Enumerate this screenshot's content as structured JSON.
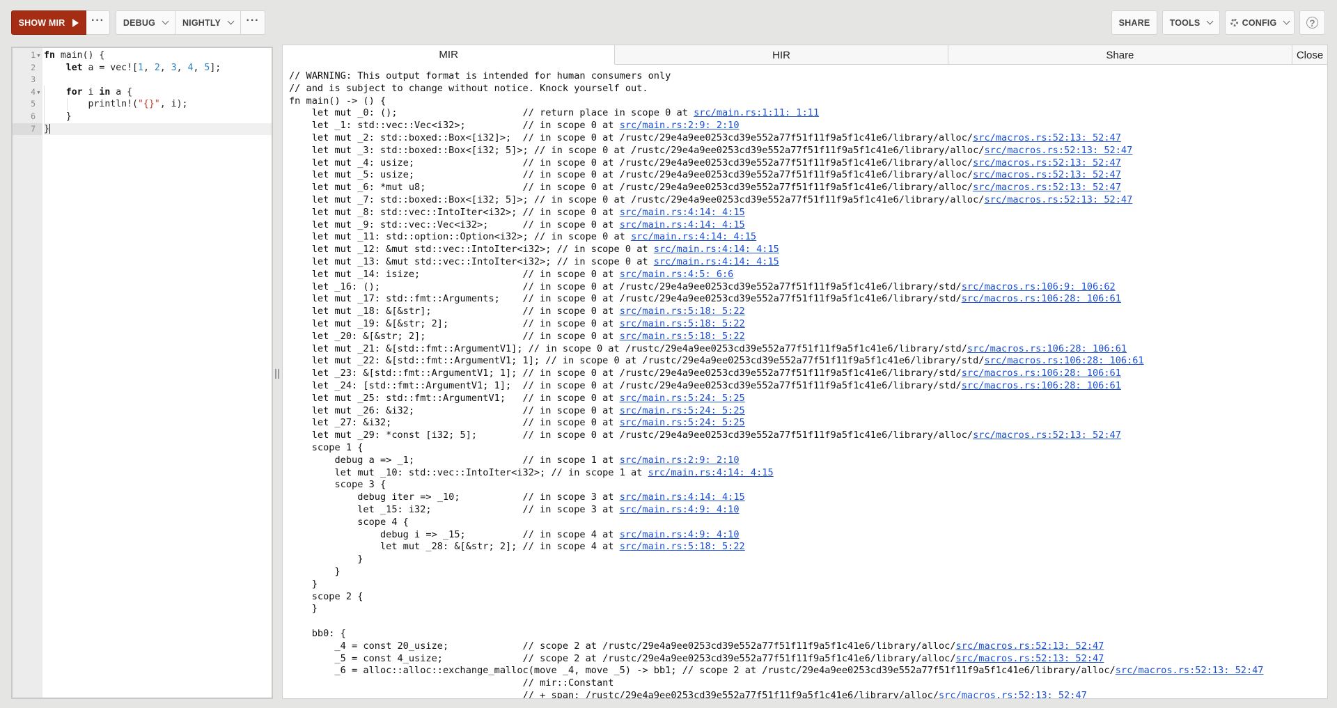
{
  "header": {
    "run_label": "SHOW MIR",
    "more_run_label": "···",
    "mode_label": "DEBUG",
    "channel_label": "NIGHTLY",
    "more_label": "···",
    "share_label": "SHARE",
    "tools_label": "TOOLS",
    "config_label": "CONFIG",
    "help_label": "?"
  },
  "colors": {
    "run_button": "#a42d14",
    "link": "#1a4fd6",
    "number_literal": "#2c85c9",
    "string_literal": "#c0392b"
  },
  "editor": {
    "line_numbers": [
      "1",
      "2",
      "3",
      "4",
      "5",
      "6",
      "7"
    ],
    "fold_marker_lines": [
      "1",
      "4"
    ],
    "code_lines": [
      "fn main() {",
      "    let a = vec![1, 2, 3, 4, 5];",
      "",
      "    for i in a {",
      "        println!(\"{}\", i);",
      "    }",
      "}"
    ],
    "cursor_line": "7"
  },
  "output": {
    "tabs": [
      {
        "label": "MIR",
        "active": true
      },
      {
        "label": "HIR",
        "active": false
      },
      {
        "label": "Share",
        "active": false
      },
      {
        "label": "Close",
        "active": false
      }
    ],
    "lines": [
      {
        "pre": "// WARNING: This output format is intended for human consumers only"
      },
      {
        "pre": "// and is subject to change without notice. Knock yourself out."
      },
      {
        "pre": "fn main() -> () {"
      },
      {
        "pre": "    let mut _0: ();                      // return place in scope 0 at ",
        "link": "src/main.rs:1:11: 1:11"
      },
      {
        "pre": "    let _1: std::vec::Vec<i32>;          // in scope 0 at ",
        "link": "src/main.rs:2:9: 2:10"
      },
      {
        "pre": "    let mut _2: std::boxed::Box<[i32]>;  // in scope 0 at /rustc/29e4a9ee0253cd39e552a77f51f11f9a5f1c41e6/library/alloc/",
        "link": "src/macros.rs:52:13: 52:47"
      },
      {
        "pre": "    let mut _3: std::boxed::Box<[i32; 5]>; // in scope 0 at /rustc/29e4a9ee0253cd39e552a77f51f11f9a5f1c41e6/library/alloc/",
        "link": "src/macros.rs:52:13: 52:47"
      },
      {
        "pre": "    let mut _4: usize;                   // in scope 0 at /rustc/29e4a9ee0253cd39e552a77f51f11f9a5f1c41e6/library/alloc/",
        "link": "src/macros.rs:52:13: 52:47"
      },
      {
        "pre": "    let mut _5: usize;                   // in scope 0 at /rustc/29e4a9ee0253cd39e552a77f51f11f9a5f1c41e6/library/alloc/",
        "link": "src/macros.rs:52:13: 52:47"
      },
      {
        "pre": "    let mut _6: *mut u8;                 // in scope 0 at /rustc/29e4a9ee0253cd39e552a77f51f11f9a5f1c41e6/library/alloc/",
        "link": "src/macros.rs:52:13: 52:47"
      },
      {
        "pre": "    let mut _7: std::boxed::Box<[i32; 5]>; // in scope 0 at /rustc/29e4a9ee0253cd39e552a77f51f11f9a5f1c41e6/library/alloc/",
        "link": "src/macros.rs:52:13: 52:47"
      },
      {
        "pre": "    let mut _8: std::vec::IntoIter<i32>; // in scope 0 at ",
        "link": "src/main.rs:4:14: 4:15"
      },
      {
        "pre": "    let mut _9: std::vec::Vec<i32>;      // in scope 0 at ",
        "link": "src/main.rs:4:14: 4:15"
      },
      {
        "pre": "    let mut _11: std::option::Option<i32>; // in scope 0 at ",
        "link": "src/main.rs:4:14: 4:15"
      },
      {
        "pre": "    let mut _12: &mut std::vec::IntoIter<i32>; // in scope 0 at ",
        "link": "src/main.rs:4:14: 4:15"
      },
      {
        "pre": "    let mut _13: &mut std::vec::IntoIter<i32>; // in scope 0 at ",
        "link": "src/main.rs:4:14: 4:15"
      },
      {
        "pre": "    let mut _14: isize;                  // in scope 0 at ",
        "link": "src/main.rs:4:5: 6:6"
      },
      {
        "pre": "    let _16: ();                         // in scope 0 at /rustc/29e4a9ee0253cd39e552a77f51f11f9a5f1c41e6/library/std/",
        "link": "src/macros.rs:106:9: 106:62"
      },
      {
        "pre": "    let mut _17: std::fmt::Arguments;    // in scope 0 at /rustc/29e4a9ee0253cd39e552a77f51f11f9a5f1c41e6/library/std/",
        "link": "src/macros.rs:106:28: 106:61"
      },
      {
        "pre": "    let mut _18: &[&str];                // in scope 0 at ",
        "link": "src/main.rs:5:18: 5:22"
      },
      {
        "pre": "    let mut _19: &[&str; 2];             // in scope 0 at ",
        "link": "src/main.rs:5:18: 5:22"
      },
      {
        "pre": "    let _20: &[&str; 2];                 // in scope 0 at ",
        "link": "src/main.rs:5:18: 5:22"
      },
      {
        "pre": "    let mut _21: &[std::fmt::ArgumentV1]; // in scope 0 at /rustc/29e4a9ee0253cd39e552a77f51f11f9a5f1c41e6/library/std/",
        "link": "src/macros.rs:106:28: 106:61"
      },
      {
        "pre": "    let mut _22: &[std::fmt::ArgumentV1; 1]; // in scope 0 at /rustc/29e4a9ee0253cd39e552a77f51f11f9a5f1c41e6/library/std/",
        "link": "src/macros.rs:106:28: 106:61"
      },
      {
        "pre": "    let _23: &[std::fmt::ArgumentV1; 1]; // in scope 0 at /rustc/29e4a9ee0253cd39e552a77f51f11f9a5f1c41e6/library/std/",
        "link": "src/macros.rs:106:28: 106:61"
      },
      {
        "pre": "    let _24: [std::fmt::ArgumentV1; 1];  // in scope 0 at /rustc/29e4a9ee0253cd39e552a77f51f11f9a5f1c41e6/library/std/",
        "link": "src/macros.rs:106:28: 106:61"
      },
      {
        "pre": "    let mut _25: std::fmt::ArgumentV1;   // in scope 0 at ",
        "link": "src/main.rs:5:24: 5:25"
      },
      {
        "pre": "    let mut _26: &i32;                   // in scope 0 at ",
        "link": "src/main.rs:5:24: 5:25"
      },
      {
        "pre": "    let _27: &i32;                       // in scope 0 at ",
        "link": "src/main.rs:5:24: 5:25"
      },
      {
        "pre": "    let mut _29: *const [i32; 5];        // in scope 0 at /rustc/29e4a9ee0253cd39e552a77f51f11f9a5f1c41e6/library/alloc/",
        "link": "src/macros.rs:52:13: 52:47"
      },
      {
        "pre": "    scope 1 {"
      },
      {
        "pre": "        debug a => _1;                   // in scope 1 at ",
        "link": "src/main.rs:2:9: 2:10"
      },
      {
        "pre": "        let mut _10: std::vec::IntoIter<i32>; // in scope 1 at ",
        "link": "src/main.rs:4:14: 4:15"
      },
      {
        "pre": "        scope 3 {"
      },
      {
        "pre": "            debug iter => _10;           // in scope 3 at ",
        "link": "src/main.rs:4:14: 4:15"
      },
      {
        "pre": "            let _15: i32;                // in scope 3 at ",
        "link": "src/main.rs:4:9: 4:10"
      },
      {
        "pre": "            scope 4 {"
      },
      {
        "pre": "                debug i => _15;          // in scope 4 at ",
        "link": "src/main.rs:4:9: 4:10"
      },
      {
        "pre": "                let mut _28: &[&str; 2]; // in scope 4 at ",
        "link": "src/main.rs:5:18: 5:22"
      },
      {
        "pre": "            }"
      },
      {
        "pre": "        }"
      },
      {
        "pre": "    }"
      },
      {
        "pre": "    scope 2 {"
      },
      {
        "pre": "    }"
      },
      {
        "pre": ""
      },
      {
        "pre": "    bb0: {"
      },
      {
        "pre": "        _4 = const 20_usize;             // scope 2 at /rustc/29e4a9ee0253cd39e552a77f51f11f9a5f1c41e6/library/alloc/",
        "link": "src/macros.rs:52:13: 52:47"
      },
      {
        "pre": "        _5 = const 4_usize;              // scope 2 at /rustc/29e4a9ee0253cd39e552a77f51f11f9a5f1c41e6/library/alloc/",
        "link": "src/macros.rs:52:13: 52:47"
      },
      {
        "pre": "        _6 = alloc::alloc::exchange_malloc(move _4, move _5) -> bb1; // scope 2 at /rustc/29e4a9ee0253cd39e552a77f51f11f9a5f1c41e6/library/alloc/",
        "link": "src/macros.rs:52:13: 52:47"
      },
      {
        "pre": "                                         // mir::Constant"
      },
      {
        "pre": "                                         // + span: /rustc/29e4a9ee0253cd39e552a77f51f11f9a5f1c41e6/library/alloc/",
        "link": "src/macros.rs:52:13: 52:47"
      }
    ]
  }
}
